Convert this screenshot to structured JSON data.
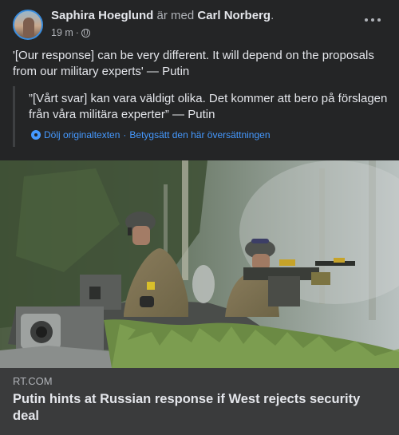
{
  "post": {
    "author": "Saphira Hoeglund",
    "with_text": "är med",
    "tagged": "Carl Norberg",
    "period": ".",
    "time": "19 m",
    "dot": "·",
    "privacy_icon": "globe-icon",
    "more_icon": "more-horizontal-icon",
    "text": "'[Our response] can be very different. It will depend on the proposals from our military experts' — Putin",
    "original_text": "”[Vårt svar] kan vara väldigt olika. Det kommer att bero på förslagen från våra militära experter” — Putin",
    "translation": {
      "icon": "gear-icon",
      "hide_original": "Dölj originaltexten",
      "separator": "·",
      "rate": "Betygsätt den här översättningen"
    }
  },
  "link": {
    "domain": "RT.COM",
    "title": "Putin hints at Russian response if West rejects security deal"
  },
  "colors": {
    "background": "#242526",
    "card": "#3a3b3c",
    "link_blue": "#4599ff",
    "text_primary": "#e4e6eb",
    "text_secondary": "#b0b3b8"
  }
}
